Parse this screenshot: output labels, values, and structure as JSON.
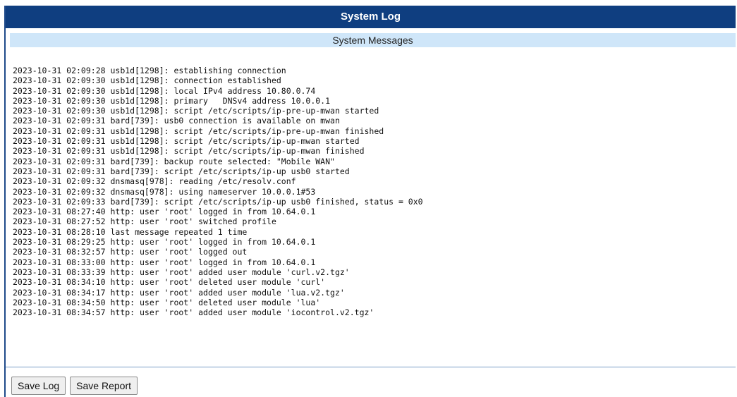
{
  "header": {
    "title": "System Log"
  },
  "section": {
    "title": "System Messages"
  },
  "log": {
    "lines": [
      "2023-10-31 02:09:28 usb1d[1298]: establishing connection",
      "2023-10-31 02:09:30 usb1d[1298]: connection established",
      "2023-10-31 02:09:30 usb1d[1298]: local IPv4 address 10.80.0.74",
      "2023-10-31 02:09:30 usb1d[1298]: primary   DNSv4 address 10.0.0.1",
      "2023-10-31 02:09:30 usb1d[1298]: script /etc/scripts/ip-pre-up-mwan started",
      "2023-10-31 02:09:31 bard[739]: usb0 connection is available on mwan",
      "2023-10-31 02:09:31 usb1d[1298]: script /etc/scripts/ip-pre-up-mwan finished",
      "2023-10-31 02:09:31 usb1d[1298]: script /etc/scripts/ip-up-mwan started",
      "2023-10-31 02:09:31 usb1d[1298]: script /etc/scripts/ip-up-mwan finished",
      "2023-10-31 02:09:31 bard[739]: backup route selected: \"Mobile WAN\"",
      "2023-10-31 02:09:31 bard[739]: script /etc/scripts/ip-up usb0 started",
      "2023-10-31 02:09:32 dnsmasq[978]: reading /etc/resolv.conf",
      "2023-10-31 02:09:32 dnsmasq[978]: using nameserver 10.0.0.1#53",
      "2023-10-31 02:09:33 bard[739]: script /etc/scripts/ip-up usb0 finished, status = 0x0",
      "2023-10-31 08:27:40 http: user 'root' logged in from 10.64.0.1",
      "2023-10-31 08:27:52 http: user 'root' switched profile",
      "2023-10-31 08:28:10 last message repeated 1 time",
      "2023-10-31 08:29:25 http: user 'root' logged in from 10.64.0.1",
      "2023-10-31 08:32:57 http: user 'root' logged out",
      "2023-10-31 08:33:00 http: user 'root' logged in from 10.64.0.1",
      "2023-10-31 08:33:39 http: user 'root' added user module 'curl.v2.tgz'",
      "2023-10-31 08:34:10 http: user 'root' deleted user module 'curl'",
      "2023-10-31 08:34:17 http: user 'root' added user module 'lua.v2.tgz'",
      "2023-10-31 08:34:50 http: user 'root' deleted user module 'lua'",
      "2023-10-31 08:34:57 http: user 'root' added user module 'iocontrol.v2.tgz'"
    ]
  },
  "buttons": {
    "save_log": "Save Log",
    "save_report": "Save Report"
  }
}
